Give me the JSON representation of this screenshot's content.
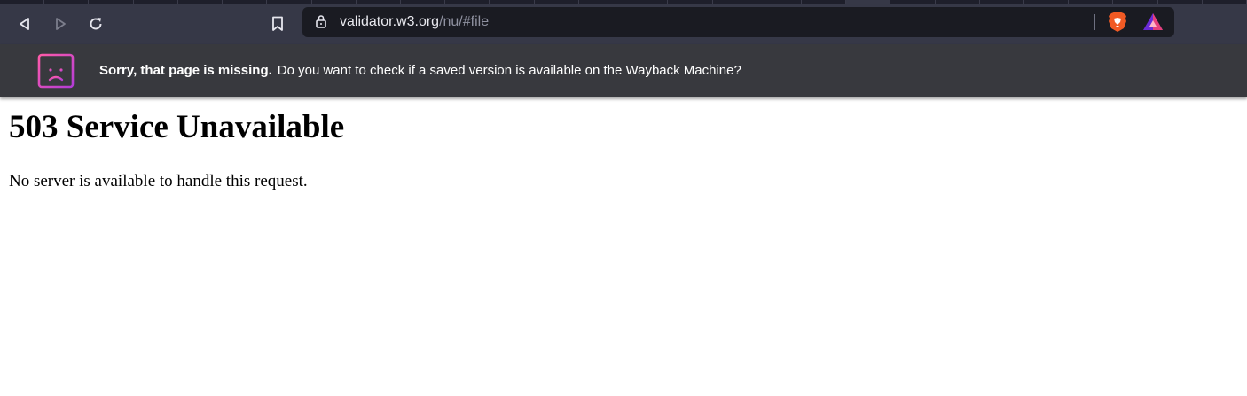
{
  "browser": {
    "url": {
      "host": "validator.w3.org",
      "path": "/nu/#file"
    },
    "icons": {
      "back": "back-icon",
      "forward": "forward-icon",
      "reload": "reload-icon",
      "bookmark": "bookmark-icon",
      "lock": "lock-icon",
      "brave_shields": "brave-shields-icon",
      "brave_rewards": "brave-rewards-icon"
    },
    "colors": {
      "toolbar": "#363847",
      "urlbar": "#1a1b22",
      "infobar": "#38393e"
    }
  },
  "infobar": {
    "title": "Sorry, that page is missing.",
    "message": "Do you want to check if a saved version is available on the Wayback Machine?",
    "icon": "sad-page-icon"
  },
  "page": {
    "heading": "503 Service Unavailable",
    "body": "No server is available to handle this request."
  }
}
